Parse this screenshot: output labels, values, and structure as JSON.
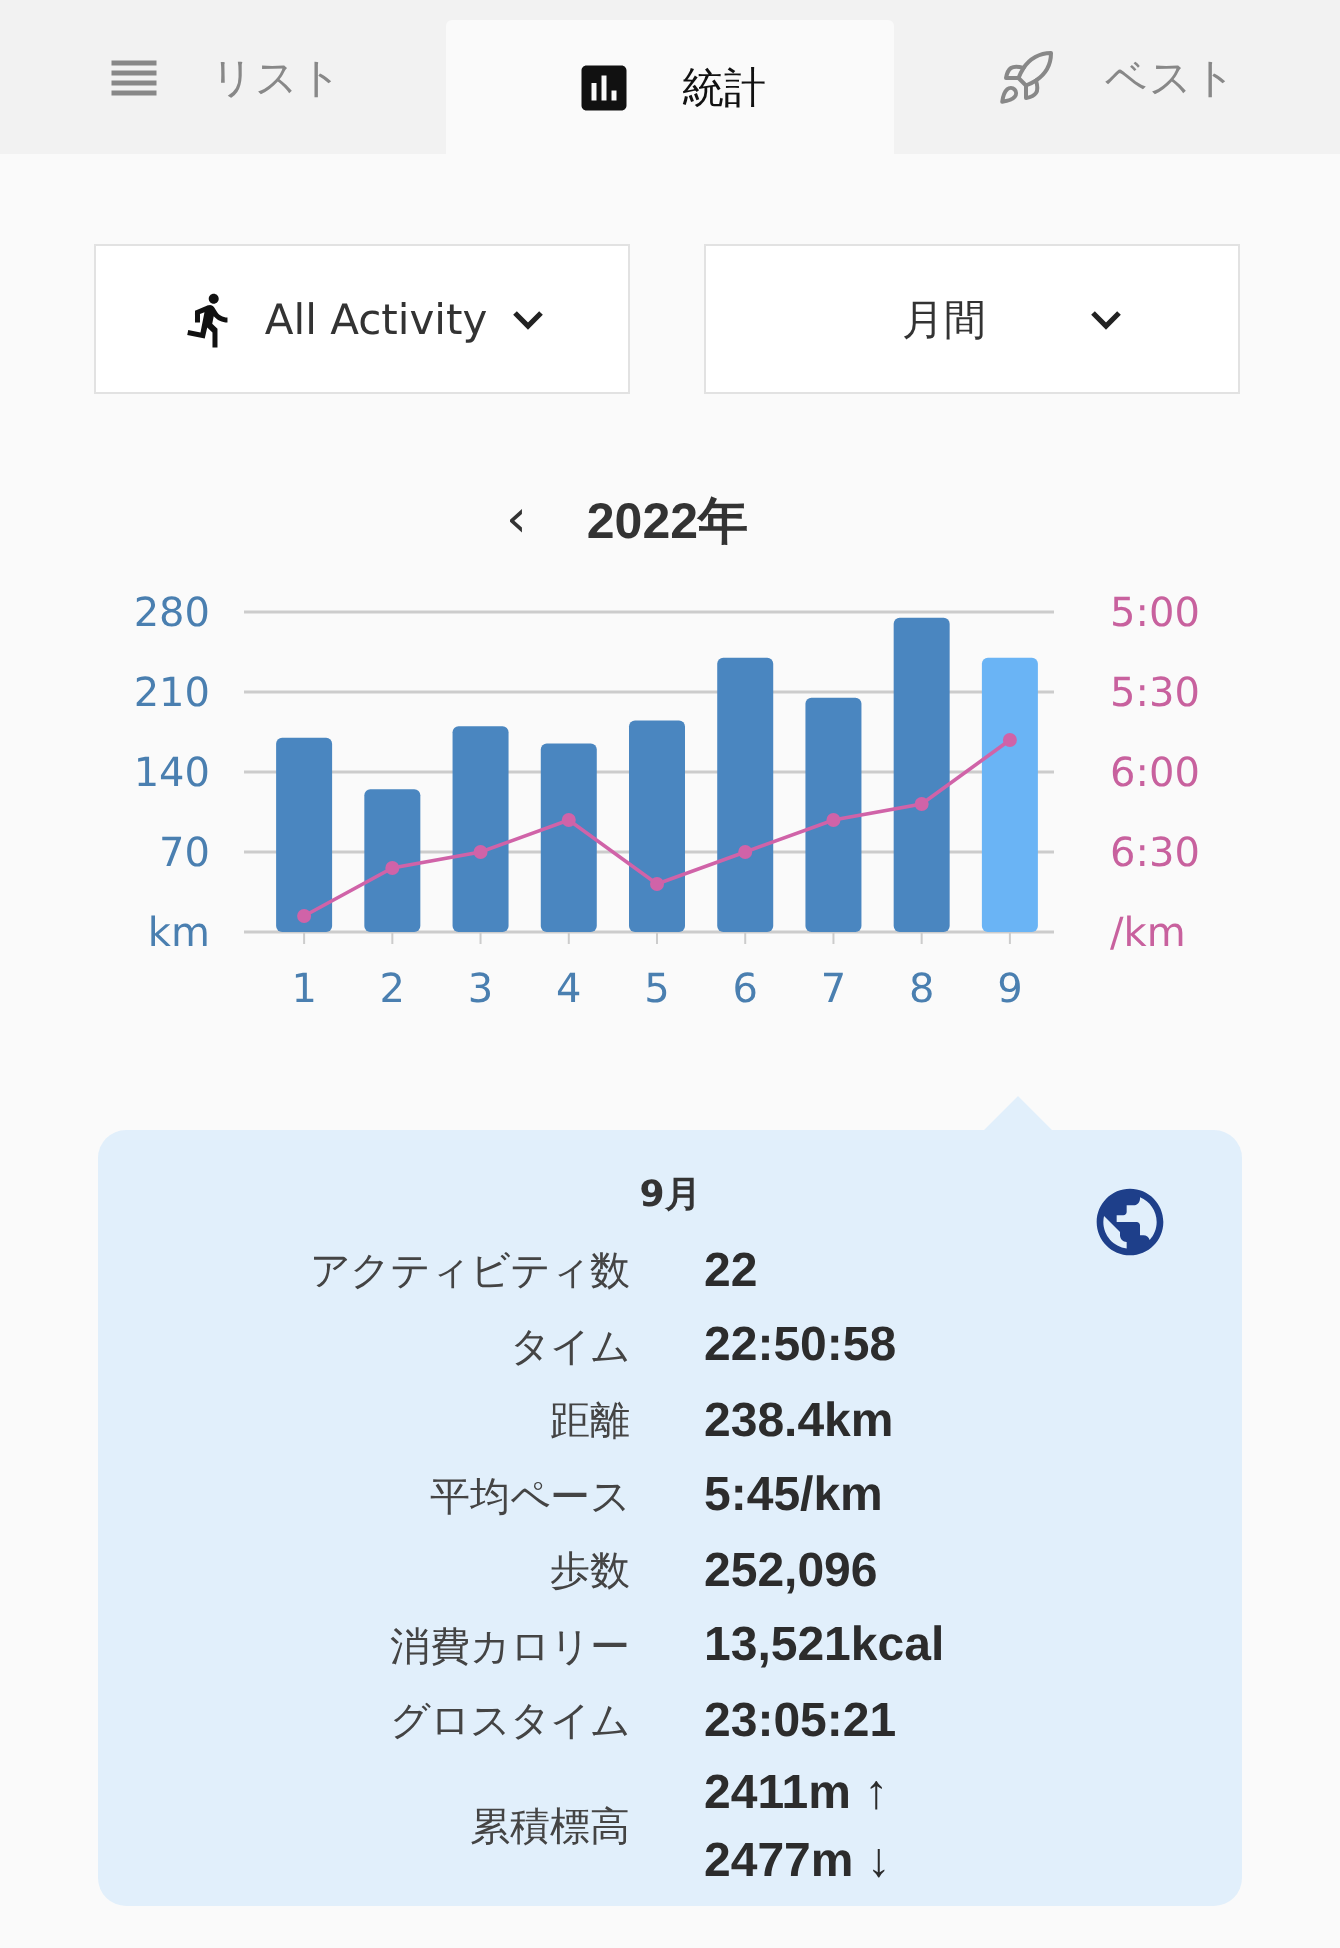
{
  "tabs": [
    {
      "label": "リスト",
      "selected": false
    },
    {
      "label": "統計",
      "selected": true
    },
    {
      "label": "ベスト",
      "selected": false
    }
  ],
  "filters": [
    {
      "kind": "activity",
      "value": "All Activity"
    },
    {
      "kind": "period",
      "value": "月間"
    }
  ],
  "year_nav": {
    "prev": "‹",
    "title": "2022年"
  },
  "chart": {
    "chart_data": {
      "type": "bar",
      "stacked": true,
      "grid": true,
      "categories": [
        "1",
        "2",
        "3",
        "4",
        "5",
        "6",
        "7",
        "8",
        "9"
      ],
      "ylim": [
        0,
        280
      ],
      "yticks": [
        {
          "value": 0,
          "label": "km"
        },
        70,
        140,
        210,
        280
      ],
      "series": [
        {
          "color": "#4a86c0",
          "values": [
            170,
            125,
            180,
            165,
            185,
            240,
            205,
            275,
            null
          ]
        },
        {
          "color": "#6ab4f5",
          "values": [
            null,
            null,
            null,
            null,
            null,
            null,
            null,
            null,
            240
          ]
        },
        {
          "color": "#d063a8",
          "type": "line",
          "axis": "y2",
          "marker": "circle",
          "values": [
            6.9,
            6.6,
            6.5,
            6.3,
            6.7,
            6.5,
            6.3,
            6.2,
            5.8
          ]
        }
      ],
      "y2lim": [
        7,
        5
      ],
      "y2ticks": [
        {
          "value": 7,
          "label": "/km"
        },
        {
          "value": 6.5,
          "label": "6:30"
        },
        {
          "value": 6,
          "label": "6:00"
        },
        {
          "value": 5.5,
          "label": "5:30"
        },
        {
          "value": 5,
          "label": "5:00"
        }
      ]
    }
  },
  "detail": {
    "title": "9月",
    "rows": [
      {
        "label": "アクティビティ数",
        "values": [
          "22"
        ]
      },
      {
        "label": "タイム",
        "values": [
          "22:50:58"
        ]
      },
      {
        "label": "距離",
        "values": [
          "238.4km"
        ]
      },
      {
        "label": "平均ペース",
        "values": [
          "5:45/km"
        ]
      },
      {
        "label": "歩数",
        "values": [
          "252,096"
        ]
      },
      {
        "label": "消費カロリー",
        "values": [
          "13,521kcal"
        ]
      },
      {
        "label": "グロスタイム",
        "values": [
          "23:05:21"
        ]
      },
      {
        "label": "累積標高",
        "values": [
          "2411m ↑",
          "2477m ↓"
        ]
      }
    ]
  }
}
